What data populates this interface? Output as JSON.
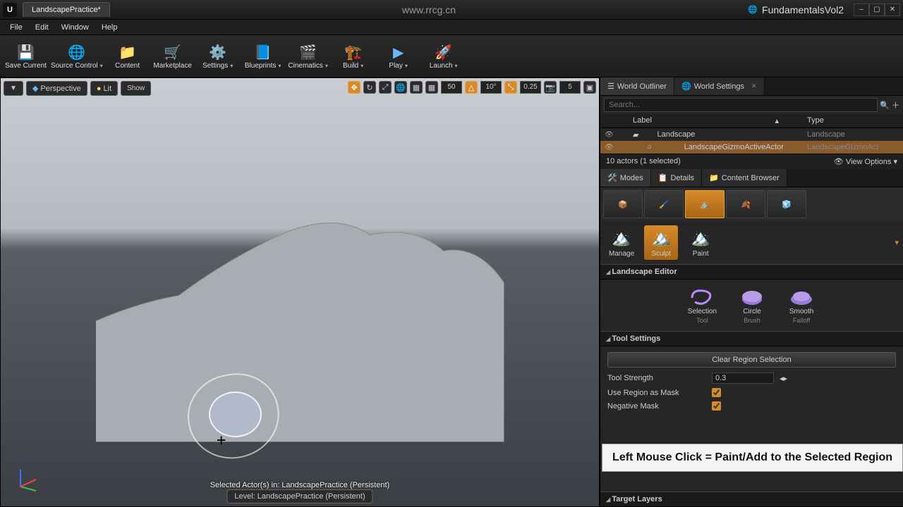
{
  "title_tab": "LandscapePractice*",
  "title_center": "www.rrcg.cn",
  "project_name": "FundamentalsVol2",
  "window_buttons": [
    "–",
    "▢",
    "✕"
  ],
  "menu": [
    "File",
    "Edit",
    "Window",
    "Help"
  ],
  "toolbar": [
    {
      "label": "Save Current",
      "icon": "💾"
    },
    {
      "label": "Source Control",
      "icon": "🌐",
      "dd": true
    },
    {
      "label": "Content",
      "icon": "📁"
    },
    {
      "label": "Marketplace",
      "icon": "🛒"
    },
    {
      "label": "Settings",
      "icon": "⚙️",
      "dd": true
    },
    {
      "label": "Blueprints",
      "icon": "📘",
      "dd": true
    },
    {
      "label": "Cinematics",
      "icon": "🎬",
      "dd": true
    },
    {
      "label": "Build",
      "icon": "🏗️",
      "dd": true
    },
    {
      "label": "Play",
      "icon": "▶",
      "dd": true
    },
    {
      "label": "Launch",
      "icon": "🚀",
      "dd": true
    }
  ],
  "viewport": {
    "mode_dd": "▼",
    "perspective": "Perspective",
    "lit": "Lit",
    "show": "Show",
    "grid_val": "50",
    "angle_val": "10°",
    "scale_val": "0.25",
    "cam_val": "5",
    "selected_text": "Selected Actor(s) in: LandscapePractice (Persistent)",
    "level_text": "Level: LandscapePractice (Persistent)"
  },
  "outliner": {
    "tab1": "World Outliner",
    "tab2": "World Settings",
    "search_ph": "Search...",
    "col_label": "Label",
    "col_type": "Type",
    "rows": [
      {
        "name": "Landscape",
        "type": "Landscape",
        "sel": false,
        "child": false
      },
      {
        "name": "LandscapeGizmoActiveActor",
        "type": "LandscapeGizmoAct",
        "sel": true,
        "child": true
      }
    ],
    "count": "10 actors (1 selected)",
    "view_opts": "View Options ▾"
  },
  "modes": {
    "tab_modes": "Modes",
    "tab_details": "Details",
    "tab_content": "Content Browser",
    "sub": [
      {
        "tx": "Manage"
      },
      {
        "tx": "Sculpt",
        "sel": true
      },
      {
        "tx": "Paint"
      }
    ]
  },
  "landscape_editor": {
    "hdr": "Landscape Editor",
    "items": [
      {
        "tx": "Selection",
        "sub": "Tool"
      },
      {
        "tx": "Circle",
        "sub": "Brush"
      },
      {
        "tx": "Smooth",
        "sub": "Falloff"
      }
    ]
  },
  "tool_settings": {
    "hdr": "Tool Settings",
    "clear": "Clear Region Selection",
    "strength_lbl": "Tool Strength",
    "strength_val": "0.3",
    "mask_lbl": "Use Region as Mask",
    "neg_lbl": "Negative Mask"
  },
  "target_layers": {
    "hdr": "Target Layers"
  },
  "hint": "Left Mouse Click = Paint/Add to the Selected Region"
}
